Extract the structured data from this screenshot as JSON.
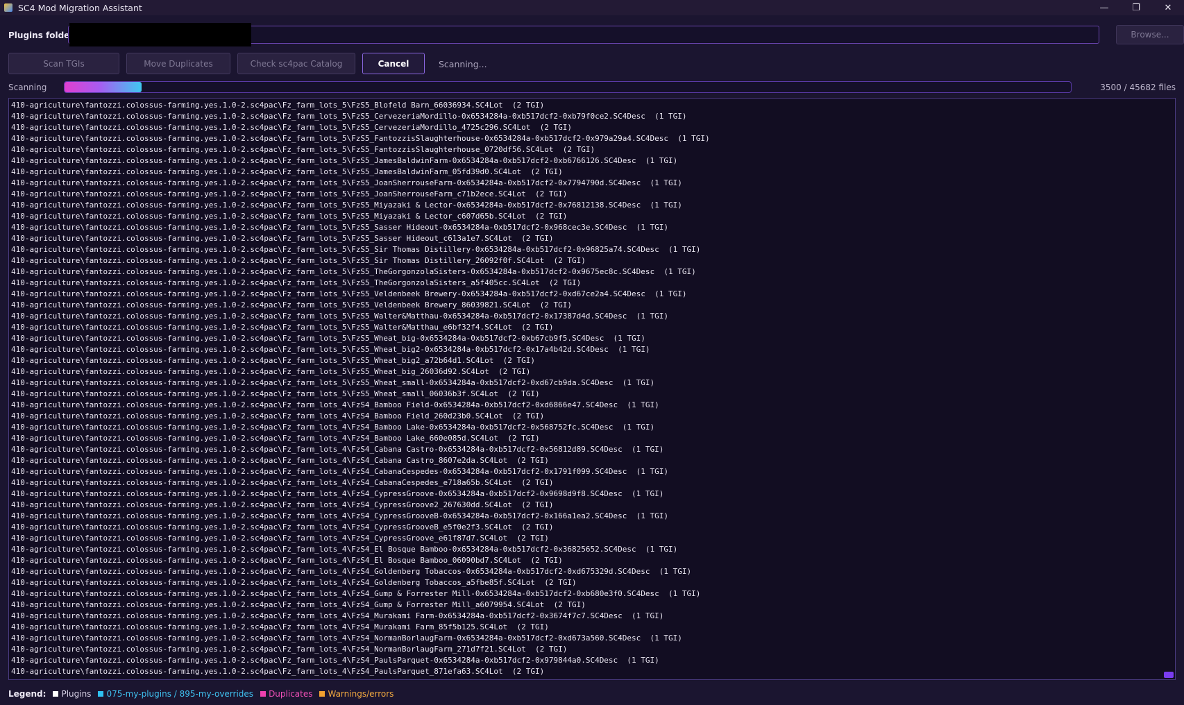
{
  "window": {
    "title": "SC4 Mod Migration Assistant",
    "minimize_glyph": "—",
    "restore_glyph": "❐",
    "close_glyph": "✕"
  },
  "plugins": {
    "label": "Plugins folder:",
    "value": "",
    "browse_label": "Browse..."
  },
  "toolbar": {
    "scan_label": "Scan TGIs",
    "move_label": "Move Duplicates",
    "check_label": "Check sc4pac Catalog",
    "cancel_label": "Cancel",
    "status": "Scanning..."
  },
  "progress": {
    "label": "Scanning",
    "current": 3500,
    "total": 45682,
    "text": "3500 / 45682 files"
  },
  "log": {
    "lines": [
      "410-agriculture\\fantozzi.colossus-farming.yes.1.0-2.sc4pac\\Fz_farm_lots_5\\FzS5_Blofeld Barn_66036934.SC4Lot  (2 TGI)",
      "410-agriculture\\fantozzi.colossus-farming.yes.1.0-2.sc4pac\\Fz_farm_lots_5\\FzS5_CervezeriaMordillo-0x6534284a-0xb517dcf2-0xb79f0ce2.SC4Desc  (1 TGI)",
      "410-agriculture\\fantozzi.colossus-farming.yes.1.0-2.sc4pac\\Fz_farm_lots_5\\FzS5_CervezeriaMordillo_4725c296.SC4Lot  (2 TGI)",
      "410-agriculture\\fantozzi.colossus-farming.yes.1.0-2.sc4pac\\Fz_farm_lots_5\\FzS5_FantozzisSlaughterhouse-0x6534284a-0xb517dcf2-0x979a29a4.SC4Desc  (1 TGI)",
      "410-agriculture\\fantozzi.colossus-farming.yes.1.0-2.sc4pac\\Fz_farm_lots_5\\FzS5_FantozzisSlaughterhouse_0720df56.SC4Lot  (2 TGI)",
      "410-agriculture\\fantozzi.colossus-farming.yes.1.0-2.sc4pac\\Fz_farm_lots_5\\FzS5_JamesBaldwinFarm-0x6534284a-0xb517dcf2-0xb6766126.SC4Desc  (1 TGI)",
      "410-agriculture\\fantozzi.colossus-farming.yes.1.0-2.sc4pac\\Fz_farm_lots_5\\FzS5_JamesBaldwinFarm_05fd39d0.SC4Lot  (2 TGI)",
      "410-agriculture\\fantozzi.colossus-farming.yes.1.0-2.sc4pac\\Fz_farm_lots_5\\FzS5_JoanSherrouseFarm-0x6534284a-0xb517dcf2-0x7794790d.SC4Desc  (1 TGI)",
      "410-agriculture\\fantozzi.colossus-farming.yes.1.0-2.sc4pac\\Fz_farm_lots_5\\FzS5_JoanSherrouseFarm_c71b2ece.SC4Lot  (2 TGI)",
      "410-agriculture\\fantozzi.colossus-farming.yes.1.0-2.sc4pac\\Fz_farm_lots_5\\FzS5_Miyazaki & Lector-0x6534284a-0xb517dcf2-0x76812138.SC4Desc  (1 TGI)",
      "410-agriculture\\fantozzi.colossus-farming.yes.1.0-2.sc4pac\\Fz_farm_lots_5\\FzS5_Miyazaki & Lector_c607d65b.SC4Lot  (2 TGI)",
      "410-agriculture\\fantozzi.colossus-farming.yes.1.0-2.sc4pac\\Fz_farm_lots_5\\FzS5_Sasser Hideout-0x6534284a-0xb517dcf2-0x968cec3e.SC4Desc  (1 TGI)",
      "410-agriculture\\fantozzi.colossus-farming.yes.1.0-2.sc4pac\\Fz_farm_lots_5\\FzS5_Sasser Hideout_c613a1e7.SC4Lot  (2 TGI)",
      "410-agriculture\\fantozzi.colossus-farming.yes.1.0-2.sc4pac\\Fz_farm_lots_5\\FzS5_Sir Thomas Distillery-0x6534284a-0xb517dcf2-0x96825a74.SC4Desc  (1 TGI)",
      "410-agriculture\\fantozzi.colossus-farming.yes.1.0-2.sc4pac\\Fz_farm_lots_5\\FzS5_Sir Thomas Distillery_26092f0f.SC4Lot  (2 TGI)",
      "410-agriculture\\fantozzi.colossus-farming.yes.1.0-2.sc4pac\\Fz_farm_lots_5\\FzS5_TheGorgonzolaSisters-0x6534284a-0xb517dcf2-0x9675ec8c.SC4Desc  (1 TGI)",
      "410-agriculture\\fantozzi.colossus-farming.yes.1.0-2.sc4pac\\Fz_farm_lots_5\\FzS5_TheGorgonzolaSisters_a5f405cc.SC4Lot  (2 TGI)",
      "410-agriculture\\fantozzi.colossus-farming.yes.1.0-2.sc4pac\\Fz_farm_lots_5\\FzS5_Veldenbeek Brewery-0x6534284a-0xb517dcf2-0xd67ce2a4.SC4Desc  (1 TGI)",
      "410-agriculture\\fantozzi.colossus-farming.yes.1.0-2.sc4pac\\Fz_farm_lots_5\\FzS5_Veldenbeek Brewery_86039821.SC4Lot  (2 TGI)",
      "410-agriculture\\fantozzi.colossus-farming.yes.1.0-2.sc4pac\\Fz_farm_lots_5\\FzS5_Walter&Matthau-0x6534284a-0xb517dcf2-0x17387d4d.SC4Desc  (1 TGI)",
      "410-agriculture\\fantozzi.colossus-farming.yes.1.0-2.sc4pac\\Fz_farm_lots_5\\FzS5_Walter&Matthau_e6bf32f4.SC4Lot  (2 TGI)",
      "410-agriculture\\fantozzi.colossus-farming.yes.1.0-2.sc4pac\\Fz_farm_lots_5\\FzS5_Wheat_big-0x6534284a-0xb517dcf2-0xb67cb9f5.SC4Desc  (1 TGI)",
      "410-agriculture\\fantozzi.colossus-farming.yes.1.0-2.sc4pac\\Fz_farm_lots_5\\FzS5_Wheat_big2-0x6534284a-0xb517dcf2-0x17a4b42d.SC4Desc  (1 TGI)",
      "410-agriculture\\fantozzi.colossus-farming.yes.1.0-2.sc4pac\\Fz_farm_lots_5\\FzS5_Wheat_big2_a72b64d1.SC4Lot  (2 TGI)",
      "410-agriculture\\fantozzi.colossus-farming.yes.1.0-2.sc4pac\\Fz_farm_lots_5\\FzS5_Wheat_big_26036d92.SC4Lot  (2 TGI)",
      "410-agriculture\\fantozzi.colossus-farming.yes.1.0-2.sc4pac\\Fz_farm_lots_5\\FzS5_Wheat_small-0x6534284a-0xb517dcf2-0xd67cb9da.SC4Desc  (1 TGI)",
      "410-agriculture\\fantozzi.colossus-farming.yes.1.0-2.sc4pac\\Fz_farm_lots_5\\FzS5_Wheat_small_06036b3f.SC4Lot  (2 TGI)",
      "410-agriculture\\fantozzi.colossus-farming.yes.1.0-2.sc4pac\\Fz_farm_lots_4\\FzS4_Bamboo Field-0x6534284a-0xb517dcf2-0xd6866e47.SC4Desc  (1 TGI)",
      "410-agriculture\\fantozzi.colossus-farming.yes.1.0-2.sc4pac\\Fz_farm_lots_4\\FzS4_Bamboo Field_260d23b0.SC4Lot  (2 TGI)",
      "410-agriculture\\fantozzi.colossus-farming.yes.1.0-2.sc4pac\\Fz_farm_lots_4\\FzS4_Bamboo Lake-0x6534284a-0xb517dcf2-0x568752fc.SC4Desc  (1 TGI)",
      "410-agriculture\\fantozzi.colossus-farming.yes.1.0-2.sc4pac\\Fz_farm_lots_4\\FzS4_Bamboo Lake_660e085d.SC4Lot  (2 TGI)",
      "410-agriculture\\fantozzi.colossus-farming.yes.1.0-2.sc4pac\\Fz_farm_lots_4\\FzS4_Cabana Castro-0x6534284a-0xb517dcf2-0x56812d89.SC4Desc  (1 TGI)",
      "410-agriculture\\fantozzi.colossus-farming.yes.1.0-2.sc4pac\\Fz_farm_lots_4\\FzS4_Cabana Castro_8607e2da.SC4Lot  (2 TGI)",
      "410-agriculture\\fantozzi.colossus-farming.yes.1.0-2.sc4pac\\Fz_farm_lots_4\\FzS4_CabanaCespedes-0x6534284a-0xb517dcf2-0x1791f099.SC4Desc  (1 TGI)",
      "410-agriculture\\fantozzi.colossus-farming.yes.1.0-2.sc4pac\\Fz_farm_lots_4\\FzS4_CabanaCespedes_e718a65b.SC4Lot  (2 TGI)",
      "410-agriculture\\fantozzi.colossus-farming.yes.1.0-2.sc4pac\\Fz_farm_lots_4\\FzS4_CypressGroove-0x6534284a-0xb517dcf2-0x9698d9f8.SC4Desc  (1 TGI)",
      "410-agriculture\\fantozzi.colossus-farming.yes.1.0-2.sc4pac\\Fz_farm_lots_4\\FzS4_CypressGroove2_267630dd.SC4Lot  (2 TGI)",
      "410-agriculture\\fantozzi.colossus-farming.yes.1.0-2.sc4pac\\Fz_farm_lots_4\\FzS4_CypressGrooveB-0x6534284a-0xb517dcf2-0x166a1ea2.SC4Desc  (1 TGI)",
      "410-agriculture\\fantozzi.colossus-farming.yes.1.0-2.sc4pac\\Fz_farm_lots_4\\FzS4_CypressGrooveB_e5f0e2f3.SC4Lot  (2 TGI)",
      "410-agriculture\\fantozzi.colossus-farming.yes.1.0-2.sc4pac\\Fz_farm_lots_4\\FzS4_CypressGroove_e61f87d7.SC4Lot  (2 TGI)",
      "410-agriculture\\fantozzi.colossus-farming.yes.1.0-2.sc4pac\\Fz_farm_lots_4\\FzS4_El Bosque Bamboo-0x6534284a-0xb517dcf2-0x36825652.SC4Desc  (1 TGI)",
      "410-agriculture\\fantozzi.colossus-farming.yes.1.0-2.sc4pac\\Fz_farm_lots_4\\FzS4_El Bosque Bamboo_06090bd7.SC4Lot  (2 TGI)",
      "410-agriculture\\fantozzi.colossus-farming.yes.1.0-2.sc4pac\\Fz_farm_lots_4\\FzS4_Goldenberg Tobaccos-0x6534284a-0xb517dcf2-0xd675329d.SC4Desc  (1 TGI)",
      "410-agriculture\\fantozzi.colossus-farming.yes.1.0-2.sc4pac\\Fz_farm_lots_4\\FzS4_Goldenberg Tobaccos_a5fbe85f.SC4Lot  (2 TGI)",
      "410-agriculture\\fantozzi.colossus-farming.yes.1.0-2.sc4pac\\Fz_farm_lots_4\\FzS4_Gump & Forrester Mill-0x6534284a-0xb517dcf2-0xb680e3f0.SC4Desc  (1 TGI)",
      "410-agriculture\\fantozzi.colossus-farming.yes.1.0-2.sc4pac\\Fz_farm_lots_4\\FzS4_Gump & Forrester Mill_a6079954.SC4Lot  (2 TGI)",
      "410-agriculture\\fantozzi.colossus-farming.yes.1.0-2.sc4pac\\Fz_farm_lots_4\\FzS4_Murakami Farm-0x6534284a-0xb517dcf2-0x3674f7c7.SC4Desc  (1 TGI)",
      "410-agriculture\\fantozzi.colossus-farming.yes.1.0-2.sc4pac\\Fz_farm_lots_4\\FzS4_Murakami Farm_85f5b125.SC4Lot  (2 TGI)",
      "410-agriculture\\fantozzi.colossus-farming.yes.1.0-2.sc4pac\\Fz_farm_lots_4\\FzS4_NormanBorlaugFarm-0x6534284a-0xb517dcf2-0xd673a560.SC4Desc  (1 TGI)",
      "410-agriculture\\fantozzi.colossus-farming.yes.1.0-2.sc4pac\\Fz_farm_lots_4\\FzS4_NormanBorlaugFarm_271d7f21.SC4Lot  (2 TGI)",
      "410-agriculture\\fantozzi.colossus-farming.yes.1.0-2.sc4pac\\Fz_farm_lots_4\\FzS4_PaulsParquet-0x6534284a-0xb517dcf2-0x979844a0.SC4Desc  (1 TGI)",
      "410-agriculture\\fantozzi.colossus-farming.yes.1.0-2.sc4pac\\Fz_farm_lots_4\\FzS4_PaulsParquet_871efa63.SC4Lot  (2 TGI)"
    ]
  },
  "legend": {
    "title": "Legend:",
    "items": [
      {
        "label": "Plugins",
        "color": "#ffffff",
        "text_color": "#d6d0e4"
      },
      {
        "label": "075-my-plugins / 895-my-overrides",
        "color": "#2fc0f0",
        "text_color": "#3fc0ef"
      },
      {
        "label": "Duplicates",
        "color": "#f040b0",
        "text_color": "#ef4fb5"
      },
      {
        "label": "Warnings/errors",
        "color": "#f0a030",
        "text_color": "#f0a840"
      }
    ]
  },
  "colors": {
    "accent": "#8a66e0",
    "background": "#1b1530"
  }
}
